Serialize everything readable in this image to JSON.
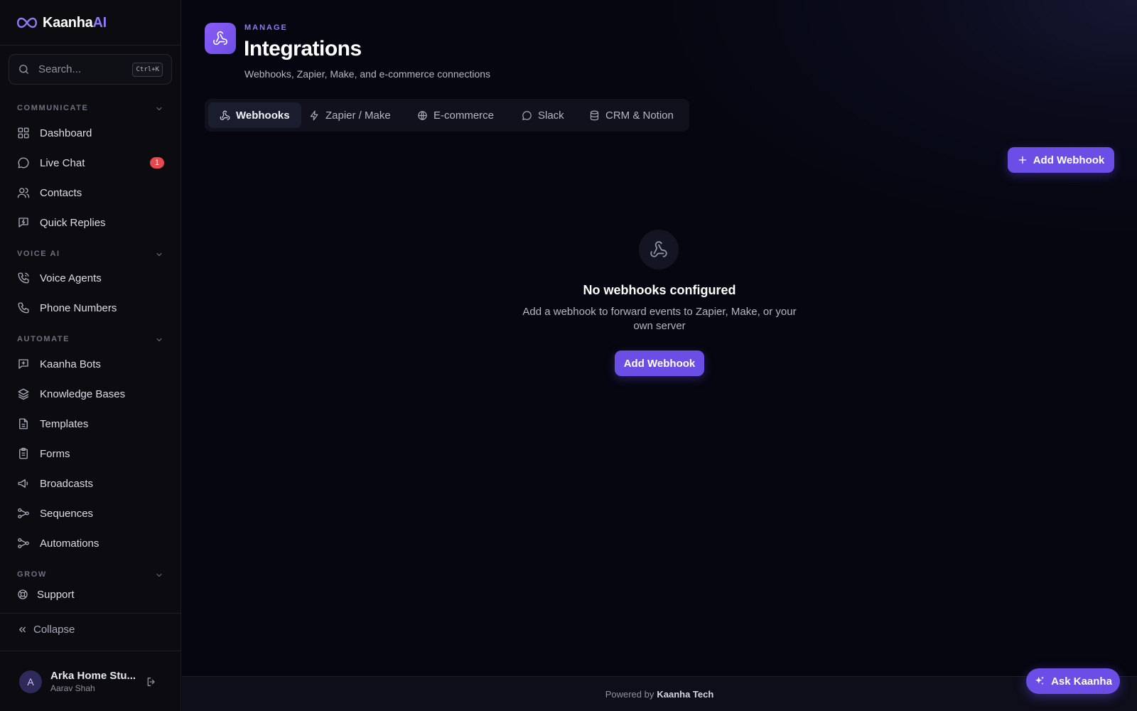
{
  "app": {
    "logo_primary": "Kaanha",
    "logo_accent": "AI",
    "accent_color": "#6b4ee6"
  },
  "search": {
    "placeholder": "Search...",
    "shortcut": "Ctrl+K"
  },
  "sidebar": {
    "sections": [
      {
        "label": "COMMUNICATE",
        "items": [
          {
            "label": "Dashboard",
            "icon": "grid-icon"
          },
          {
            "label": "Live Chat",
            "icon": "chat-bubble-icon",
            "badge": "1"
          },
          {
            "label": "Contacts",
            "icon": "users-icon"
          },
          {
            "label": "Quick Replies",
            "icon": "message-bolt-icon"
          }
        ]
      },
      {
        "label": "VOICE AI",
        "items": [
          {
            "label": "Voice Agents",
            "icon": "phone-call-icon"
          },
          {
            "label": "Phone Numbers",
            "icon": "phone-icon"
          }
        ]
      },
      {
        "label": "AUTOMATE",
        "items": [
          {
            "label": "Kaanha Bots",
            "icon": "bot-message-icon"
          },
          {
            "label": "Knowledge Bases",
            "icon": "layers-icon"
          },
          {
            "label": "Templates",
            "icon": "file-text-icon"
          },
          {
            "label": "Forms",
            "icon": "clipboard-icon"
          },
          {
            "label": "Broadcasts",
            "icon": "megaphone-icon"
          },
          {
            "label": "Sequences",
            "icon": "workflow-icon"
          },
          {
            "label": "Automations",
            "icon": "workflow-icon"
          }
        ]
      },
      {
        "label": "GROW",
        "items": [
          {
            "label": "Support",
            "icon": "lifebuoy-icon"
          }
        ]
      }
    ],
    "collapse_label": "Collapse",
    "user": {
      "initial": "A",
      "name": "Arka Home Stu...",
      "subtitle": "Aarav Shah"
    }
  },
  "header": {
    "eyebrow": "MANAGE",
    "title": "Integrations",
    "subtitle": "Webhooks, Zapier, Make, and e-commerce connections"
  },
  "tabs": [
    {
      "label": "Webhooks",
      "icon": "webhook-icon",
      "active": true
    },
    {
      "label": "Zapier / Make",
      "icon": "zap-icon",
      "active": false
    },
    {
      "label": "E-commerce",
      "icon": "globe-icon",
      "active": false
    },
    {
      "label": "Slack",
      "icon": "chat-bubble-icon",
      "active": false
    },
    {
      "label": "CRM & Notion",
      "icon": "database-icon",
      "active": false
    }
  ],
  "actions": {
    "add_webhook_label": "Add Webhook"
  },
  "empty_state": {
    "title": "No webhooks configured",
    "description": "Add a webhook to forward events to Zapier, Make, or your own server",
    "button_label": "Add Webhook"
  },
  "footer": {
    "prefix": "Powered by",
    "brand": "Kaanha Tech"
  },
  "assistant": {
    "label": "Ask Kaanha"
  }
}
